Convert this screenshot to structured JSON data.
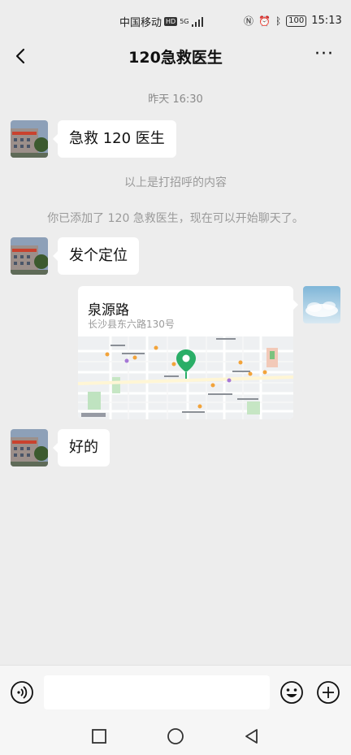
{
  "status_bar": {
    "carrier": "中国移动",
    "hd_badge": "HD",
    "signal": "5G",
    "battery": "100",
    "time": "15:13"
  },
  "header": {
    "title": "120急救医生",
    "more_label": "···"
  },
  "chat": {
    "timestamp": "昨天 16:30",
    "messages": [
      {
        "text": "急救 120 医生"
      },
      {
        "text": "发个定位"
      },
      {
        "text": "好的"
      }
    ],
    "system_messages": [
      "以上是打招呼的内容",
      "你已添加了 120 急救医生，现在可以开始聊天了。"
    ],
    "location": {
      "name": "泉源路",
      "address": "长沙县东六路130号"
    }
  },
  "colors": {
    "background": "#ededed",
    "bubble": "#ffffff",
    "map_pin": "#2aae67"
  },
  "icons": {
    "back": "chevron-left-icon",
    "more": "more-dots-icon",
    "voice": "voice-icon",
    "emoji": "emoji-icon",
    "plus": "plus-icon"
  }
}
